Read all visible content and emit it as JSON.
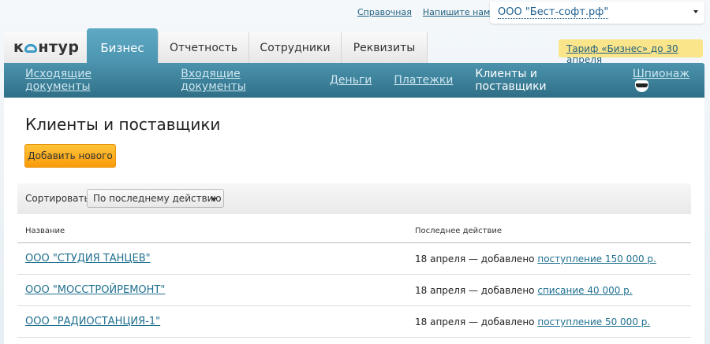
{
  "top_links": [
    "Справочная",
    "Напишите нам"
  ],
  "organization": "ООО \"Бест-софт.рф\"",
  "logo": "кОнтур",
  "tabs": [
    "Бизнес",
    "Отчетность",
    "Сотрудники",
    "Реквизиты"
  ],
  "tariff": "Тариф «Бизнес» до 30 апреля",
  "nav": [
    "Исходящие документы",
    "Входящие документы",
    "Деньги",
    "Платежки",
    "Клиенты и поставщики",
    "Шпионаж"
  ],
  "page_title": "Клиенты и поставщики",
  "add_button": "Добавить нового",
  "sort": {
    "label": "Сортировать:",
    "value": "По последнему действию"
  },
  "columns": [
    "Название",
    "Последнее действие"
  ],
  "rows": [
    {
      "name": "ООО \"СТУДИЯ ТАНЦЕВ\"",
      "action": "18 апреля — добавлено",
      "link": "поступление 150 000 р."
    },
    {
      "name": "ООО \"МОССТРОЙРЕМОНТ\"",
      "action": "18 апреля — добавлено",
      "link": "списание 40 000 р."
    },
    {
      "name": "ООО \"РАДИОСТАНЦИЯ-1\"",
      "action": "18 апреля — добавлено",
      "link": "поступление 50 000 р."
    }
  ]
}
